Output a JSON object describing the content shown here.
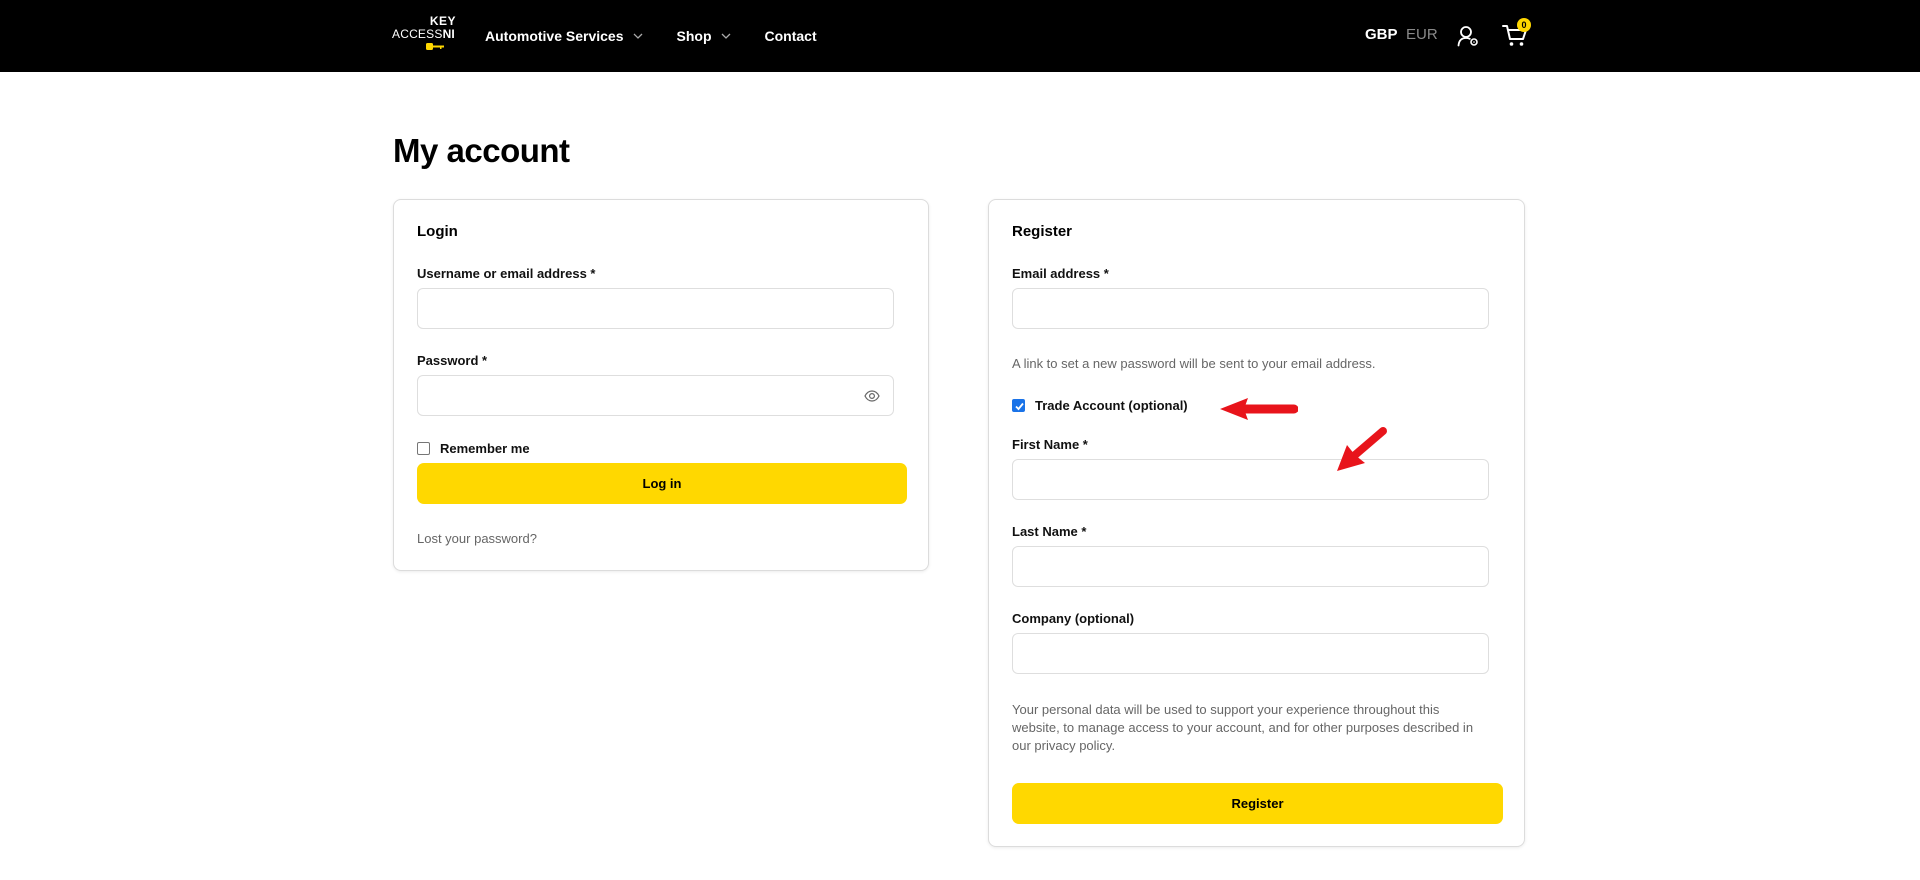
{
  "header": {
    "logo": {
      "line1": "KEY",
      "line2_a": "ACCESS",
      "line2_b": "NI"
    },
    "nav": [
      {
        "label": "Automotive Services",
        "has_dropdown": true
      },
      {
        "label": "Shop",
        "has_dropdown": true
      },
      {
        "label": "Contact",
        "has_dropdown": false
      }
    ],
    "currency": {
      "active": "GBP",
      "inactive": "EUR"
    },
    "cart_count": "0",
    "icons": {
      "account": "user-settings-icon",
      "cart": "cart-icon"
    }
  },
  "page": {
    "title": "My account"
  },
  "login": {
    "title": "Login",
    "username_label": "Username or email address *",
    "username_value": "",
    "password_label": "Password *",
    "password_value": "",
    "remember_label": "Remember me",
    "remember_checked": false,
    "submit_label": "Log in",
    "lost_password": "Lost your password?"
  },
  "register": {
    "title": "Register",
    "email_label": "Email address *",
    "email_value": "",
    "password_note": "A link to set a new password will be sent to your email address.",
    "trade_label": "Trade Account (optional)",
    "trade_checked": true,
    "first_name_label": "First Name *",
    "first_name_value": "",
    "last_name_label": "Last Name *",
    "last_name_value": "",
    "company_label": "Company (optional)",
    "company_value": "",
    "privacy_line1": "Your personal data will be used to support your experience throughout this",
    "privacy_line2": "website, to manage access to your account, and for other purposes described in",
    "privacy_pre_link": "our ",
    "privacy_link": "privacy policy",
    "privacy_post_link": ".",
    "submit_label": "Register"
  },
  "colors": {
    "brand_yellow": "#ffd800",
    "header_bg": "#000000",
    "annotation_red": "#e8141b",
    "checkbox_blue": "#1a73e8"
  }
}
